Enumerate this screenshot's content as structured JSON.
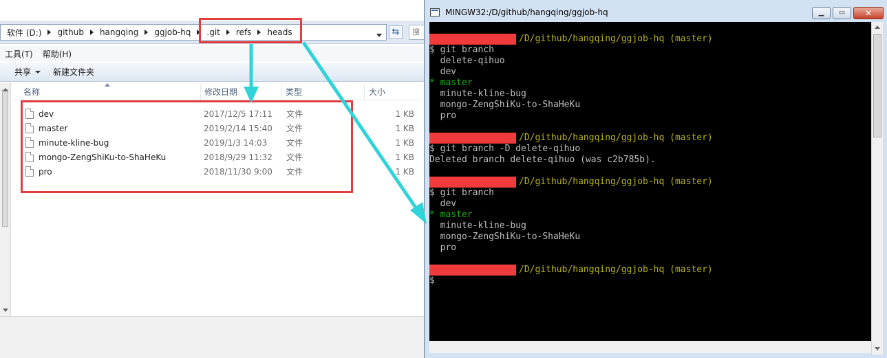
{
  "explorer": {
    "breadcrumbs": [
      "软件 (D:)",
      "github",
      "hangqing",
      "ggjob-hq",
      ".git",
      "refs",
      "heads"
    ],
    "search_placeholder": "搜",
    "menu": [
      "工具(T)",
      "帮助(H)"
    ],
    "toolbar": {
      "share_label": "共享",
      "new_folder_label": "新建文件夹"
    },
    "columns": {
      "name": "名称",
      "date": "修改日期",
      "type": "类型",
      "size": "大小"
    },
    "files": [
      {
        "name": "dev",
        "date": "2017/12/5 17:11",
        "type": "文件",
        "size": "1 KB"
      },
      {
        "name": "master",
        "date": "2019/2/14 15:40",
        "type": "文件",
        "size": "1 KB"
      },
      {
        "name": "minute-kline-bug",
        "date": "2019/1/3 14:03",
        "type": "文件",
        "size": "1 KB"
      },
      {
        "name": "mongo-ZengShiKu-to-ShaHeKu",
        "date": "2018/9/29 11:32",
        "type": "文件",
        "size": "1 KB"
      },
      {
        "name": "pro",
        "date": "2018/11/30 9:00",
        "type": "文件",
        "size": "1 KB"
      }
    ]
  },
  "terminal": {
    "title": "MINGW32:/D/github/hangqing/ggjob-hq",
    "prompt_path": "/D/github/hangqing/ggjob-hq (master)",
    "block1": {
      "cmd": "$ git branch",
      "branches": [
        "  delete-qihuo",
        "  dev"
      ],
      "current": "* master",
      "branches_after": [
        "  minute-kline-bug",
        "  mongo-ZengShiKu-to-ShaHeKu",
        "  pro"
      ]
    },
    "block2": {
      "cmd": "$ git branch -D delete-qihuo",
      "output": "Deleted branch delete-qihuo (was c2b785b)."
    },
    "block3": {
      "cmd": "$ git branch",
      "branches": [
        "  dev"
      ],
      "current": "* master",
      "branches_after": [
        "  minute-kline-bug",
        "  mongo-ZengShiKu-to-ShaHeKu",
        "  pro"
      ]
    },
    "final_prompt": "$",
    "colors": {
      "path": "#b8b21d",
      "current_branch": "#16b515",
      "redaction": "#f03a3c",
      "annotation": "#e23d3f",
      "arrow": "#2fd3d8"
    }
  }
}
